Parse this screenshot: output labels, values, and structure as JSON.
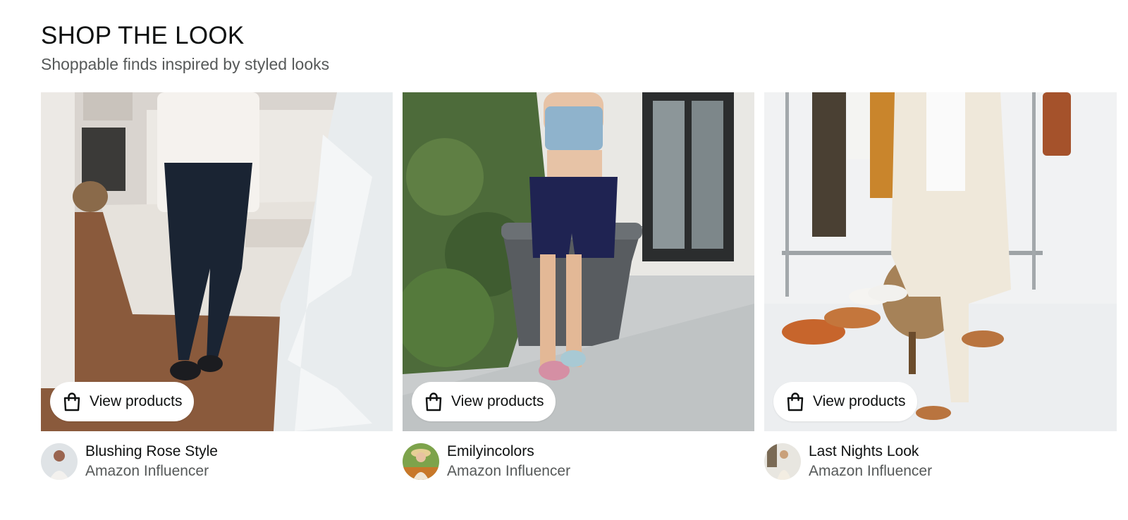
{
  "section": {
    "title": "SHOP THE LOOK",
    "subtitle": "Shoppable finds inspired by styled looks"
  },
  "cards": [
    {
      "button_label": "View products",
      "button_icon": "shopping-bag-icon",
      "creator_name": "Blushing Rose Style",
      "creator_role": "Amazon Influencer"
    },
    {
      "button_label": "View products",
      "button_icon": "shopping-bag-icon",
      "creator_name": "Emilyincolors",
      "creator_role": "Amazon Influencer"
    },
    {
      "button_label": "View products",
      "button_icon": "shopping-bag-icon",
      "creator_name": "Last Nights Look",
      "creator_role": "Amazon Influencer"
    }
  ]
}
